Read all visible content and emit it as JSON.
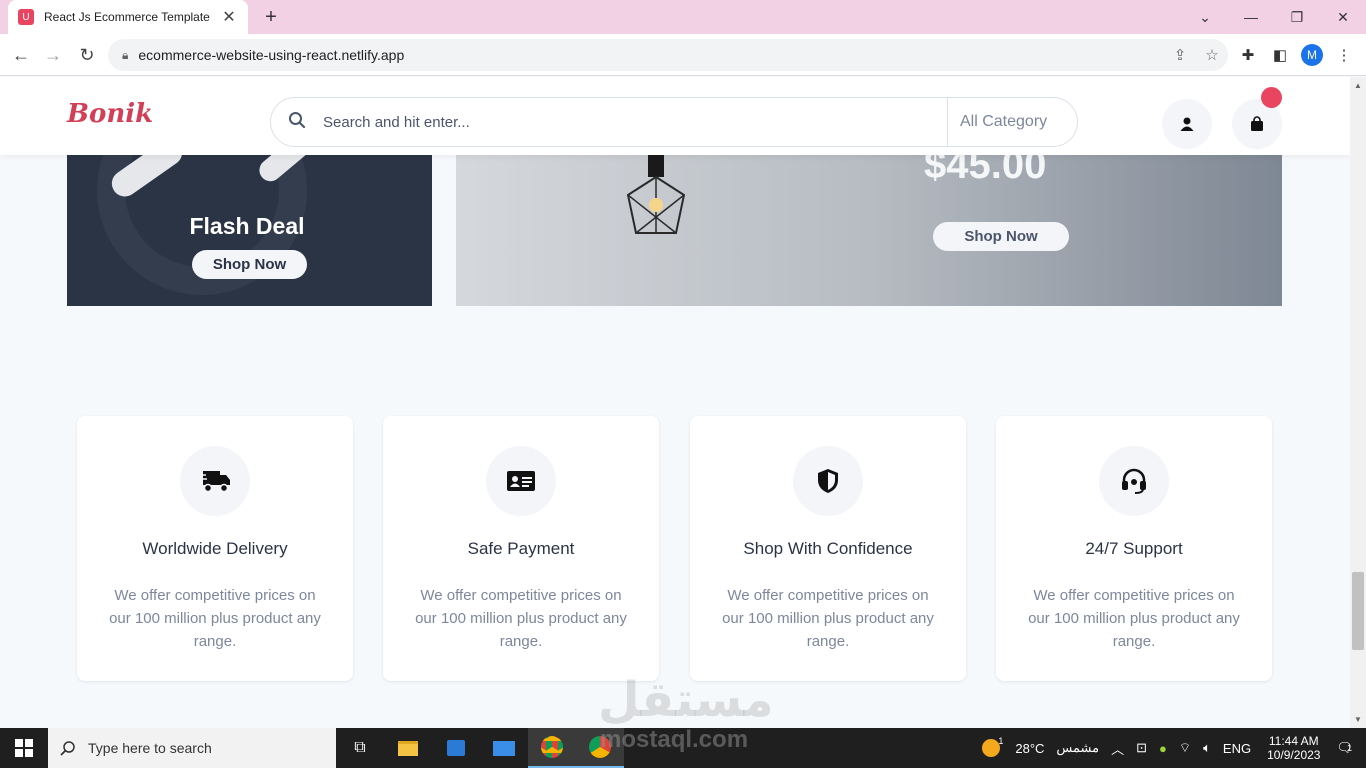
{
  "browser": {
    "tab_title": "React Js Ecommerce Template",
    "url": "ecommerce-website-using-react.netlify.app",
    "profile_initial": "M"
  },
  "header": {
    "logo": "Bonik",
    "search_placeholder": "Search and hit enter...",
    "category_label": "All Category"
  },
  "banners": {
    "flash_title": "Flash Deal",
    "flash_button": "Shop Now",
    "price": "$45.00",
    "main_button": "Shop Now"
  },
  "features": [
    {
      "title": "Worldwide Delivery",
      "text": "We offer competitive prices on our 100 million plus product any range.",
      "icon": "truck-icon"
    },
    {
      "title": "Safe Payment",
      "text": "We offer competitive prices on our 100 million plus product any range.",
      "icon": "id-card-icon"
    },
    {
      "title": "Shop With Confidence",
      "text": "We offer competitive prices on our 100 million plus product any range.",
      "icon": "shield-icon"
    },
    {
      "title": "24/7 Support",
      "text": "We offer competitive prices on our 100 million plus product any range.",
      "icon": "headset-icon"
    }
  ],
  "watermark": {
    "arabic": "مستقل",
    "latin": "mostaql.com"
  },
  "taskbar": {
    "search_placeholder": "Type here to search",
    "weather_temp": "28°C",
    "weather_label": "مشمس",
    "weather_badge": "1",
    "language": "ENG",
    "time": "11:44 AM",
    "date": "10/9/2023",
    "notification_count": "1"
  },
  "colors": {
    "brand": "#d23f57",
    "badge": "#e94560",
    "dark_banner": "#2b3445",
    "tab_bar": "#f3d1e4"
  }
}
